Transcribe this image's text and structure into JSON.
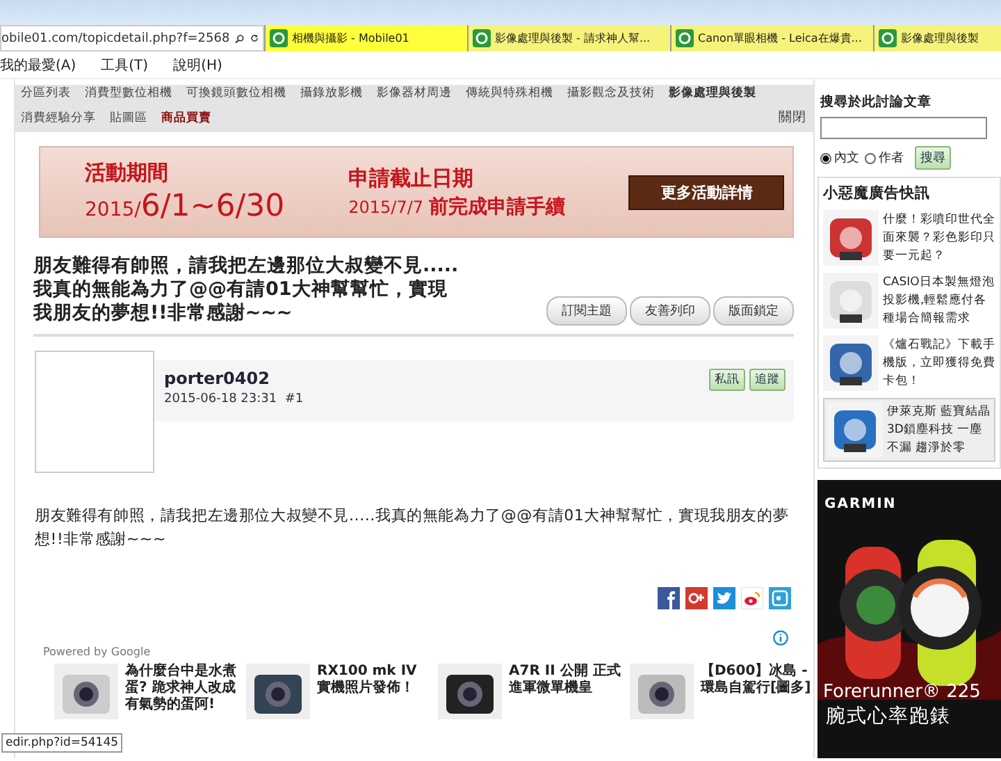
{
  "browser": {
    "url": "obile01.com/topicdetail.php?f=2568",
    "tabs": [
      {
        "title": "相機與攝影 - Mobile01",
        "selected": true
      },
      {
        "title": "影像處理與後製 - 請求神人幫...",
        "selected": false
      },
      {
        "title": "Canon單眼相機 - Leica在爆貴...",
        "selected": false
      },
      {
        "title": "影像處理與後製",
        "selected": false
      }
    ],
    "menu": [
      "我的最愛(A)",
      "工具(T)",
      "說明(H)"
    ]
  },
  "nav": {
    "items": [
      {
        "label": "分區列表",
        "kind": "normal"
      },
      {
        "label": "消費型數位相機",
        "kind": "normal"
      },
      {
        "label": "可換鏡頭數位相機",
        "kind": "normal"
      },
      {
        "label": "攝錄放影機",
        "kind": "normal"
      },
      {
        "label": "影像器材周邊",
        "kind": "normal"
      },
      {
        "label": "傳統與特殊相機",
        "kind": "normal"
      },
      {
        "label": "攝影觀念及技術",
        "kind": "normal"
      },
      {
        "label": "影像處理與後製",
        "kind": "current"
      },
      {
        "label": "消費經驗分享",
        "kind": "normal"
      },
      {
        "label": "貼圖區",
        "kind": "normal"
      },
      {
        "label": "商品買賣",
        "kind": "market"
      }
    ],
    "close": "關閉"
  },
  "banner": {
    "period_label": "活動期間",
    "period_year": "2015/",
    "period_range": "6/1~6/30",
    "deadline_label": "申請截止日期",
    "deadline_date": "2015/7/7",
    "deadline_text": "前完成申請手續",
    "button": "更多活動詳情"
  },
  "topic": {
    "title_lines": [
      "朋友難得有帥照，請我把左邊那位大叔變不見.....",
      "我真的無能為力了@@有請01大神幫幫忙，實現",
      "我朋友的夢想!!非常感謝~~~"
    ],
    "buttons": [
      "訂閱主題",
      "友善列印",
      "版面鎖定"
    ]
  },
  "post": {
    "author": "porter0402",
    "meta": "2015-06-18 23:31  #1",
    "actions": [
      "私訊",
      "追蹤"
    ],
    "body": "朋友難得有帥照，請我把左邊那位大叔變不見.....我真的無能為力了@@有請01大神幫幫忙，實現我朋友的夢想!!非常感謝~~~"
  },
  "share": [
    {
      "kind": "facebook"
    },
    {
      "kind": "google"
    },
    {
      "kind": "twitter"
    },
    {
      "kind": "weibo"
    },
    {
      "kind": "plurk"
    }
  ],
  "related": {
    "powered_by": "Powered by Google",
    "items": [
      {
        "title": "為什麼台中是水煮蛋? 跪求神人改成有氣勢的蛋阿!"
      },
      {
        "title": "RX100 mk IV 實機照片發佈！"
      },
      {
        "title": "A7R II 公開 正式進軍微單機皇"
      },
      {
        "title": "【D600】冰島 - 環島自駕行[圖多]"
      }
    ]
  },
  "status_tip": "edir.php?id=54145",
  "sidebar": {
    "search": {
      "title": "搜尋於此討論文章",
      "options": [
        {
          "label": "內文",
          "selected": true
        },
        {
          "label": "作者",
          "selected": false
        }
      ],
      "button": "搜尋"
    },
    "ads": {
      "title": "小惡魔廣告快訊",
      "items": [
        {
          "text": "什麼！彩噴印世代全面來襲？彩色影印只要一元起？",
          "highlight": false
        },
        {
          "text": "CASIO日本製無燈泡投影機,輕鬆應付各種場合簡報需求",
          "highlight": false
        },
        {
          "text": "《爐石戰記》下載手機版，立即獲得免費卡包！",
          "highlight": false
        },
        {
          "text": "伊萊克斯 藍寶結晶 3D鎖塵科技 一塵不漏 趨淨於零",
          "highlight": true
        }
      ]
    },
    "garmin": {
      "brand": "GARMIN",
      "model": "Forerunner® 225",
      "subtitle": "腕式心率跑錶"
    }
  }
}
